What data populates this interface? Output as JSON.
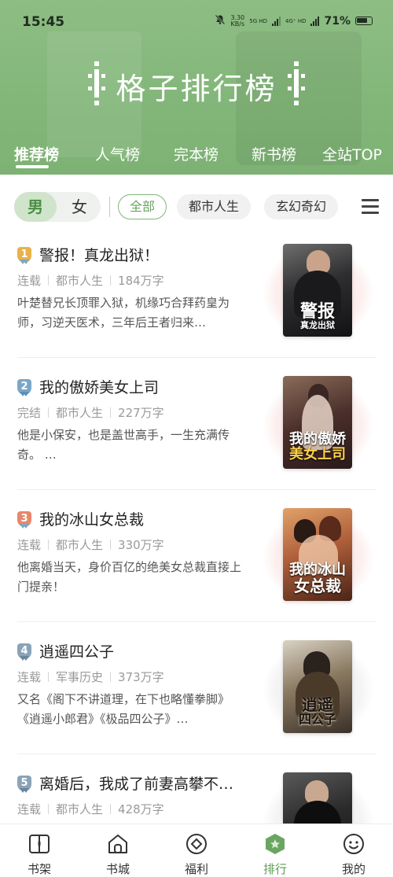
{
  "status_bar": {
    "time": "15:45",
    "net_speed_value": "3.30",
    "net_speed_unit": "KB/s",
    "network_1": "5G HD",
    "network_2": "4G⁺ HD",
    "battery_pct": "71%"
  },
  "header": {
    "title": "格子排行榜",
    "tabs": [
      "推荐榜",
      "人气榜",
      "完本榜",
      "新书榜",
      "全站TOP"
    ],
    "active_tab": 0
  },
  "filter": {
    "gender": [
      "男",
      "女"
    ],
    "gender_selected": "男",
    "chips": [
      "全部",
      "都市人生",
      "玄幻奇幻"
    ],
    "chip_selected": "全部"
  },
  "books": [
    {
      "rank": "1",
      "title": "警报！真龙出狱！",
      "status": "连载",
      "category": "都市人生",
      "words": "184万字",
      "desc": "叶楚替兄长顶罪入狱，机缘巧合拜药皇为师，习逆天医术，三年后王者归来…",
      "cover_big": "警报",
      "cover_small": "真龙出狱"
    },
    {
      "rank": "2",
      "title": "我的傲娇美女上司",
      "status": "完结",
      "category": "都市人生",
      "words": "227万字",
      "desc": "他是小保安，也是盖世高手，一生充满传奇。 …",
      "cover_big": "我的傲娇",
      "cover_small": "美女上司"
    },
    {
      "rank": "3",
      "title": "我的冰山女总裁",
      "status": "连载",
      "category": "都市人生",
      "words": "330万字",
      "desc": "他离婚当天，身价百亿的绝美女总裁直接上门提亲！",
      "cover_big": "我的冰山",
      "cover_small": "女总裁"
    },
    {
      "rank": "4",
      "title": "逍遥四公子",
      "status": "连载",
      "category": "军事历史",
      "words": "373万字",
      "desc": "又名《阁下不讲道理，在下也略懂拳脚》《逍遥小郎君》《极品四公子》…",
      "cover_big": "逍遥",
      "cover_small": "四公子"
    },
    {
      "rank": "5",
      "title": "离婚后，我成了前妻高攀不…",
      "status": "连载",
      "category": "都市人生",
      "words": "428万字",
      "desc": "",
      "cover_big": "",
      "cover_small": ""
    }
  ],
  "bottom_nav": [
    {
      "label": "书架",
      "icon": "book-icon"
    },
    {
      "label": "书城",
      "icon": "store-icon"
    },
    {
      "label": "福利",
      "icon": "gift-icon"
    },
    {
      "label": "排行",
      "icon": "ranking-icon"
    },
    {
      "label": "我的",
      "icon": "profile-icon"
    }
  ],
  "bottom_nav_active": 3,
  "colors": {
    "accent": "#7db274",
    "accent_text": "#5c9c55",
    "rank_1": "#e7b24a",
    "rank_2": "#7aa7c9",
    "rank_3": "#e8876b",
    "rank_4": "#8aa3b8",
    "rank_5": "#8aa3b8"
  }
}
